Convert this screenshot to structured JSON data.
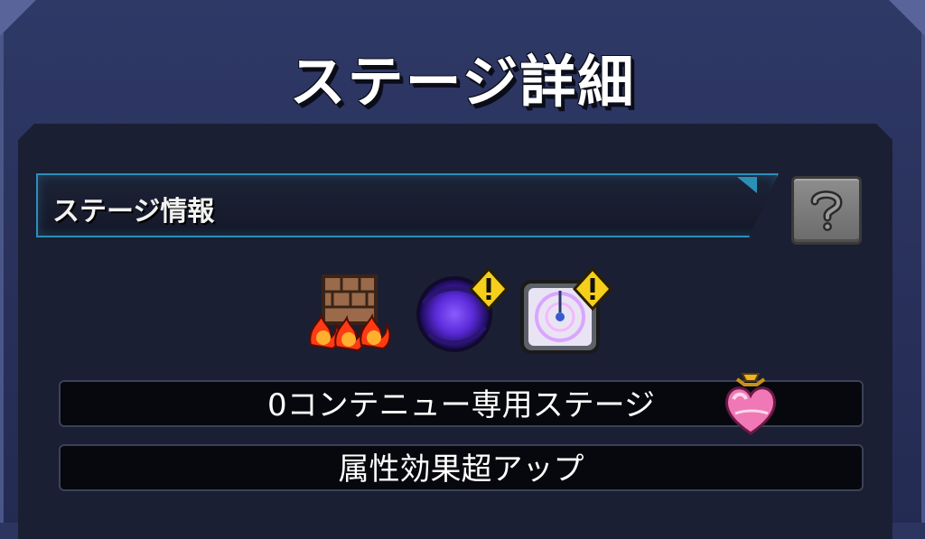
{
  "screen": {
    "title": "ステージ詳細"
  },
  "info": {
    "label": "ステージ情報",
    "help_icon": "question-mark-icon"
  },
  "gimmicks": [
    {
      "icon": "damage-wall-icon"
    },
    {
      "icon": "black-hole-icon",
      "warning": true
    },
    {
      "icon": "warp-icon",
      "warning": true
    }
  ],
  "rows": [
    {
      "text": "0コンテニュー専用ステージ",
      "icon": "heart-potion-icon"
    },
    {
      "text": "属性効果超アップ"
    }
  ],
  "colors": {
    "accent": "#2b8fb8",
    "warning": "#f5cf1c",
    "background": "#2c3560"
  }
}
